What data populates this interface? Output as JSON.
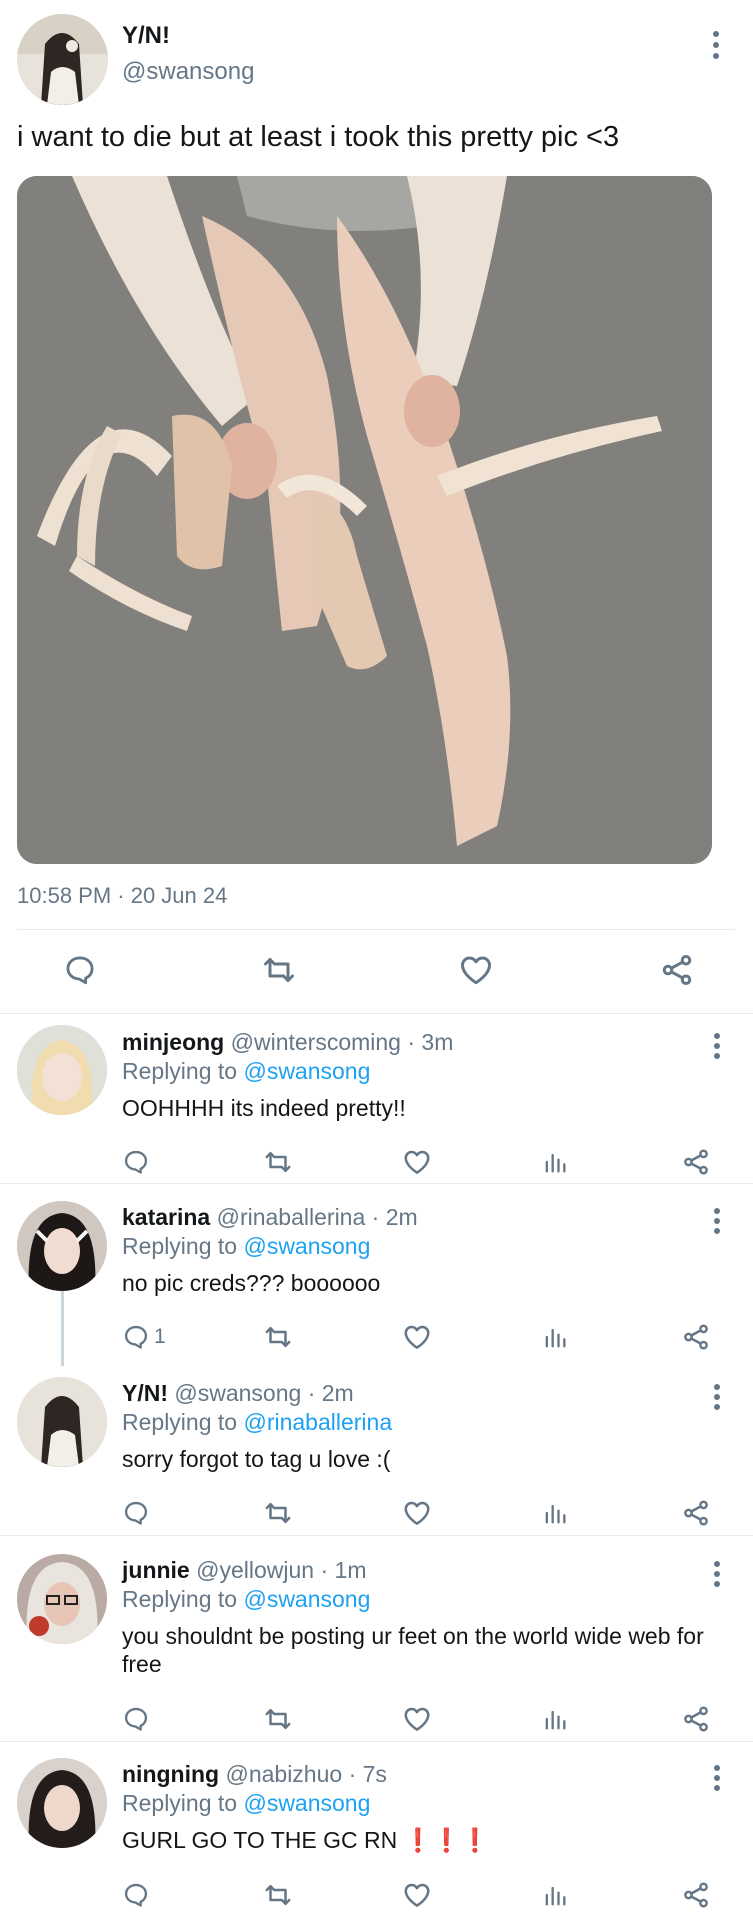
{
  "colors": {
    "accent": "#1da1f2",
    "muted": "#657786",
    "text": "#14171a",
    "divider": "#e6ecf0",
    "alert": "#e0245e"
  },
  "main_tweet": {
    "display_name": "Y/N!",
    "handle": "@swansong",
    "text": "i want to die but at least i took this pretty pic <3",
    "timestamp": "10:58 PM · 20 Jun 24",
    "icons": [
      "reply-icon",
      "retweet-icon",
      "like-icon",
      "share-icon"
    ]
  },
  "replies": [
    {
      "name": "minjeong",
      "handle": "@winterscoming",
      "time": "· 3m",
      "replying_label": "Replying to",
      "replying_to": "@swansong",
      "text": "OOHHHH its indeed pretty!!",
      "reply_count": ""
    },
    {
      "name": "katarina",
      "handle": "@rinaballerina",
      "time": "· 2m",
      "replying_label": "Replying to",
      "replying_to": "@swansong",
      "text": "no pic creds??? boooooo",
      "reply_count": "1"
    },
    {
      "name": "Y/N!",
      "handle": "@swansong",
      "time": "· 2m",
      "replying_label": "Replying to",
      "replying_to": "@rinaballerina",
      "text": "sorry forgot to tag u love :(",
      "reply_count": ""
    },
    {
      "name": "junnie",
      "handle": "@yellowjun",
      "time": "· 1m",
      "replying_label": "Replying to",
      "replying_to": "@swansong",
      "text": "you shouldnt be posting ur feet on the world wide web for free",
      "reply_count": ""
    },
    {
      "name": "ningning",
      "handle": "@nabizhuo",
      "time": "· 7s",
      "replying_label": "Replying to",
      "replying_to": "@swansong",
      "text": "GURL GO TO THE GC RN",
      "text_suffix": "❗❗❗",
      "reply_count": ""
    }
  ]
}
